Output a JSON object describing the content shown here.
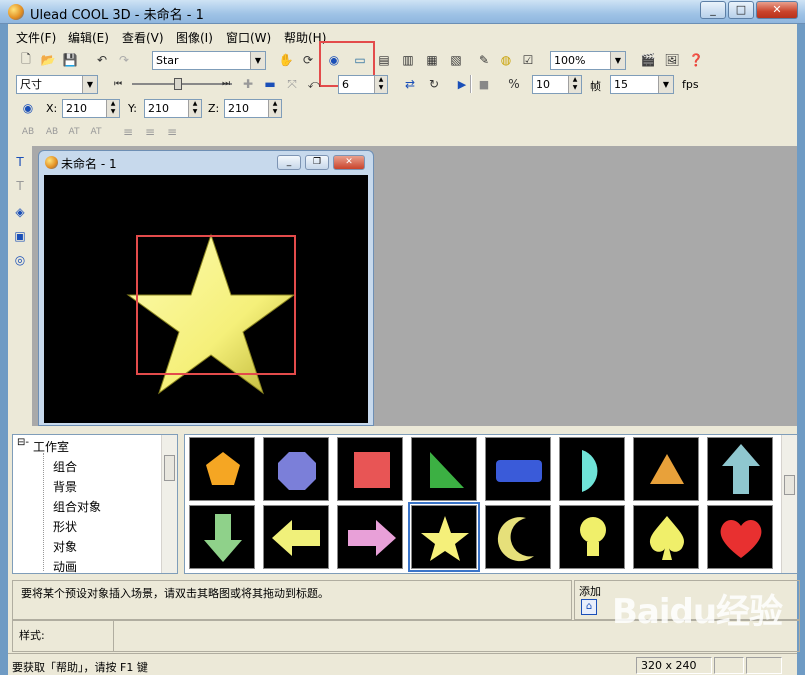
{
  "window": {
    "title": "Ulead COOL 3D - 未命名 - 1",
    "min": "_",
    "max": "□",
    "close": "✕"
  },
  "menu": [
    "文件(F)",
    "编辑(E)",
    "查看(V)",
    "图像(I)",
    "窗口(W)",
    "帮助(H)"
  ],
  "toolbar1": {
    "object_combo": "Star",
    "zoom_combo": "100%"
  },
  "toolbar2": {
    "attr_combo": "尺寸",
    "frame_value": "6",
    "fps_value": "10",
    "frame_label": "帧",
    "frames_total": "15",
    "fps_label": "fps"
  },
  "toolbar3": {
    "x_label": "X:",
    "x_value": "210",
    "y_label": "Y:",
    "y_value": "210",
    "z_label": "Z:",
    "z_value": "210"
  },
  "text_tools": [
    "AB",
    "AB",
    "AT",
    "AT"
  ],
  "child_window": {
    "title": "未命名 - 1"
  },
  "tree": {
    "root": "工作室",
    "items": [
      "组合",
      "背景",
      "组合对象",
      "形状",
      "对象",
      "动画"
    ]
  },
  "thumbnails": [
    {
      "shape": "pentagon",
      "color": "#f5a623"
    },
    {
      "shape": "octagon",
      "color": "#7b7fd9"
    },
    {
      "shape": "square",
      "color": "#e85555"
    },
    {
      "shape": "right-triangle",
      "color": "#3cb043"
    },
    {
      "shape": "rounded-rect",
      "color": "#3a5bd9"
    },
    {
      "shape": "half-circle",
      "color": "#6fe3d8"
    },
    {
      "shape": "triangle",
      "color": "#e8a13a"
    },
    {
      "shape": "arrow-up",
      "color": "#8fc7cf"
    },
    {
      "shape": "arrow-down",
      "color": "#8fd18a"
    },
    {
      "shape": "arrow-left",
      "color": "#f0f07a"
    },
    {
      "shape": "arrow-right",
      "color": "#e8a0d8"
    },
    {
      "shape": "star",
      "color": "#f5f07a",
      "selected": true
    },
    {
      "shape": "crescent",
      "color": "#e6e07a"
    },
    {
      "shape": "bulb",
      "color": "#f0ef6a"
    },
    {
      "shape": "spade",
      "color": "#f0ef6a"
    },
    {
      "shape": "heart",
      "color": "#e83030"
    }
  ],
  "hint_text": "要将某个预设对象插入场景，请双击其略图或将其拖动到标题。",
  "add_label": "添加",
  "style_label": "样式:",
  "status": {
    "help": "要获取「帮助」，请按 F1 键",
    "size": "320 x 240"
  },
  "watermark": "Baidu经验",
  "colors": {
    "accent_red": "#e34b4b",
    "star": "#f5f07a",
    "canvas": "#000000"
  }
}
